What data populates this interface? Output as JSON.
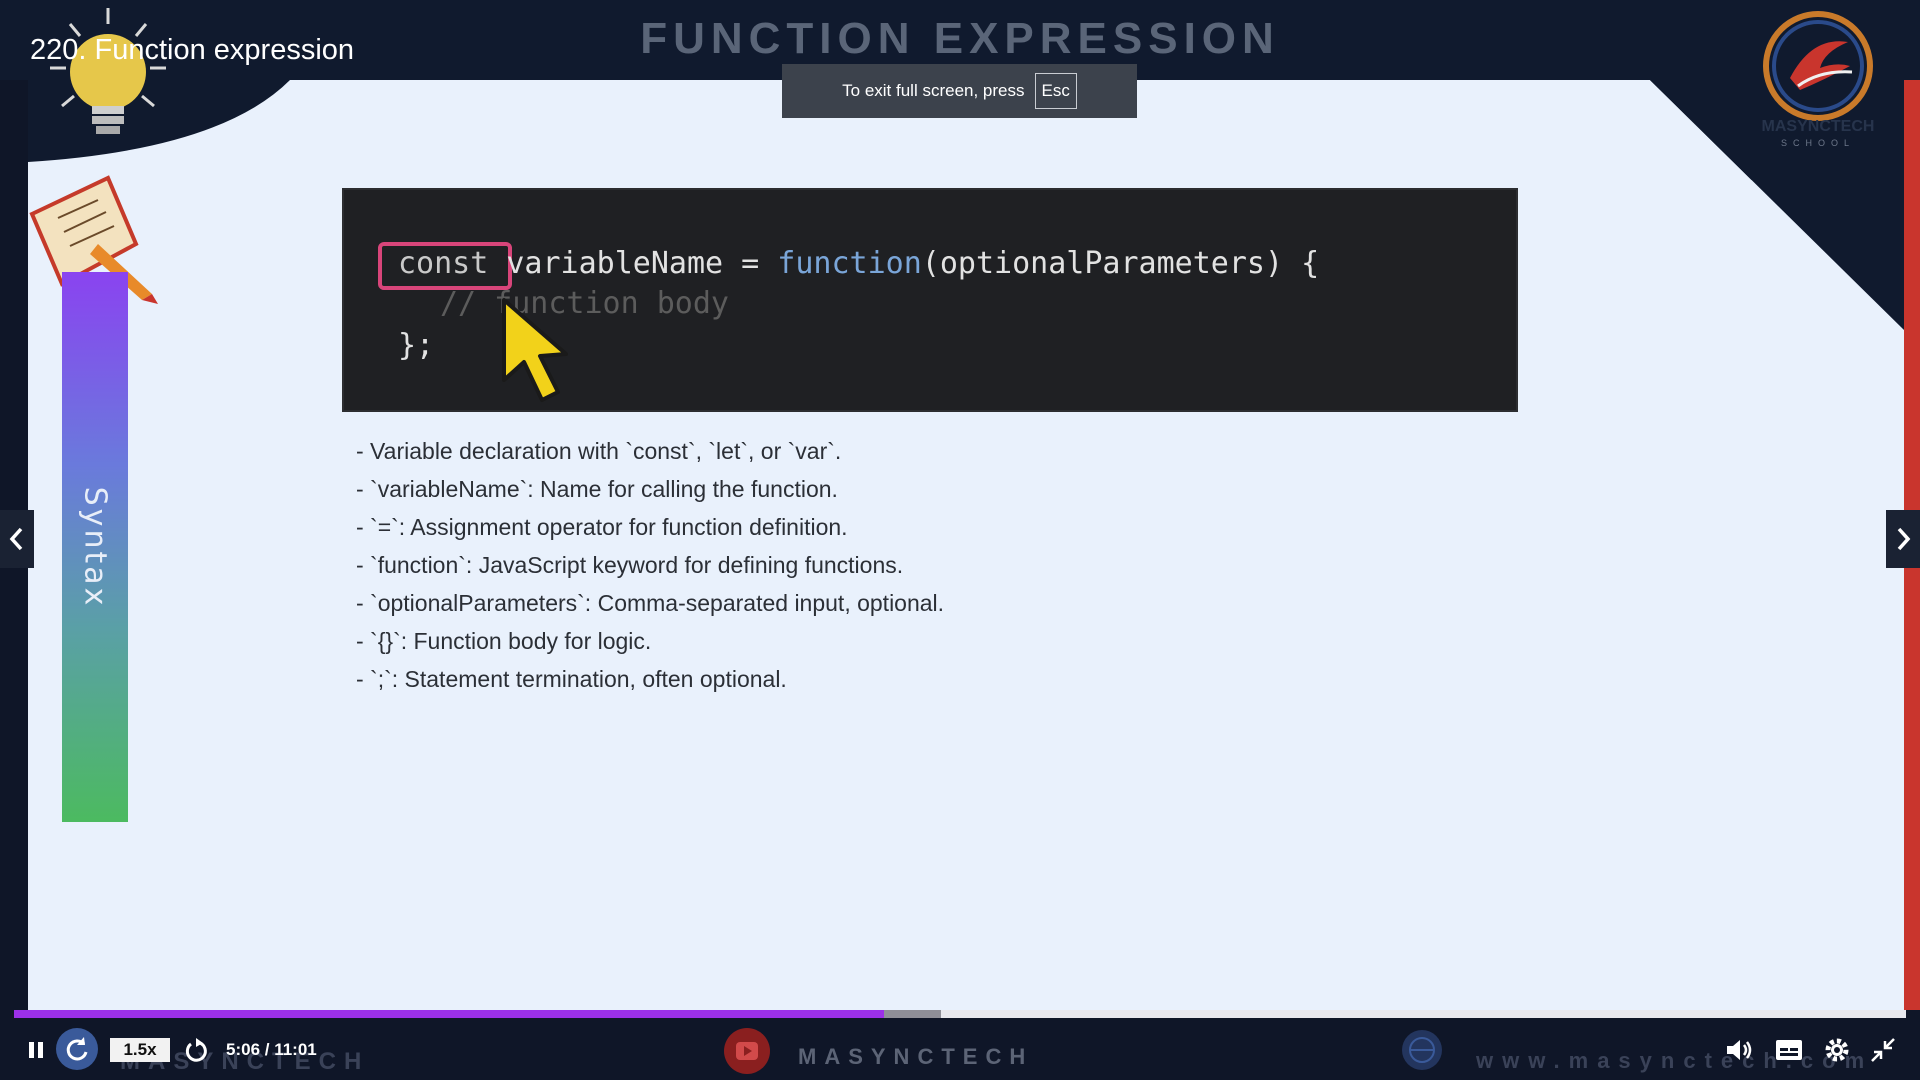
{
  "video": {
    "title": "220. Function expression"
  },
  "fullscreen_toast": {
    "message": "To exit full screen, press",
    "key": "Esc"
  },
  "slide": {
    "heading": "FUNCTION EXPRESSION",
    "side_label": "Syntax",
    "logo": {
      "name": "MASYNCTECH",
      "sub": "SCHOOL"
    },
    "code": {
      "line1_const": "const",
      "line1_mid": " variableName = ",
      "line1_fn": "function",
      "line1_end": "(optionalParameters) {",
      "line2": "// function body",
      "line3": "};"
    },
    "bullets": [
      "- Variable declaration with `const`, `let`, or `var`.",
      "- `variableName`: Name for calling the function.",
      "- `=`: Assignment operator for function definition.",
      "- `function`: JavaScript keyword for defining functions.",
      "- `optionalParameters`: Comma-separated input, optional.",
      "- `{}`: Function body for logic.",
      "- `;`: Statement termination, often optional."
    ]
  },
  "player": {
    "speed": "1.5x",
    "time": "5:06 / 11:01",
    "progress_played": 0.46,
    "progress_buffered": 0.49,
    "watermark_left": "MASYNCTECH",
    "watermark_center": "MASYNCTECH",
    "watermark_right": "www.masynctech.com",
    "icons": [
      "pause-icon",
      "rewind-icon",
      "forward-icon",
      "volume-icon",
      "captions-icon",
      "settings-icon",
      "exit-fullscreen-icon",
      "prev-arrow-icon",
      "next-arrow-icon"
    ],
    "accent_color": "#9b30e8"
  }
}
